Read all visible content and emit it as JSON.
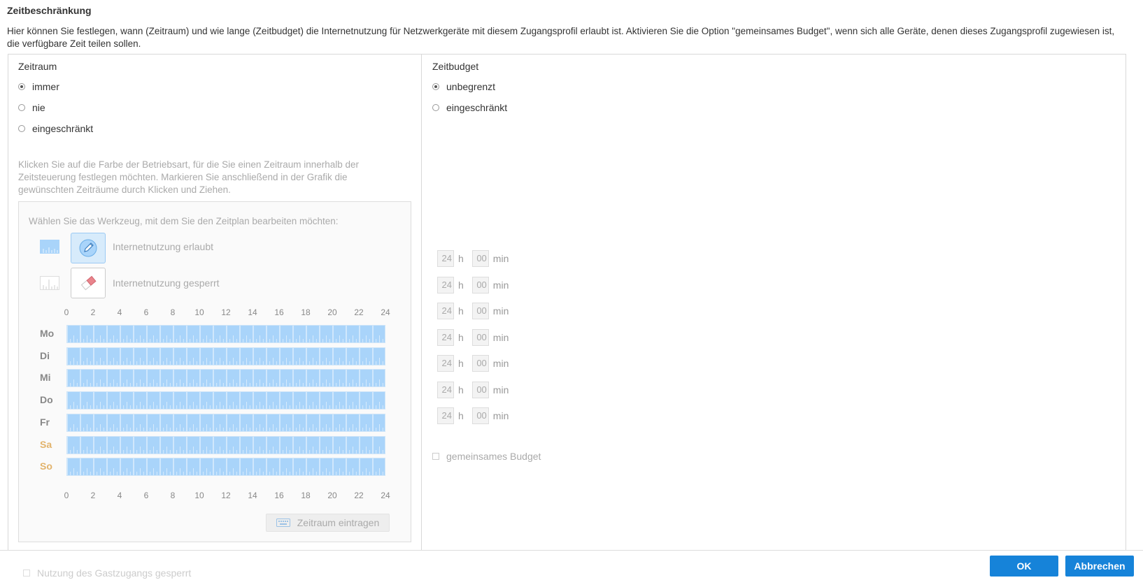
{
  "heading": "Zeitbeschränkung",
  "description": "Hier können Sie festlegen, wann (Zeitraum) und wie lange (Zeitbudget) die Internetnutzung für Netzwerkgeräte mit diesem Zugangsprofil erlaubt ist. Aktivieren Sie die Option \"gemeinsames Budget\", wenn sich alle Geräte, denen dieses Zugangsprofil zugewiesen ist, die verfügbare Zeit teilen sollen.",
  "zeitraum": {
    "title": "Zeitraum",
    "options": [
      {
        "label": "immer",
        "checked": true
      },
      {
        "label": "nie",
        "checked": false
      },
      {
        "label": "eingeschränkt",
        "checked": false
      }
    ],
    "hint": "Klicken Sie auf die Farbe der Betriebsart, für die Sie einen Zeitraum innerhalb der Zeitsteuerung festlegen möchten. Markieren Sie anschließend in der Grafik die gewünschten Zeiträume durch Klicken und Ziehen.",
    "tool_caption": "Wählen Sie das Werkzeug, mit dem Sie den Zeitplan bearbeiten möchten:",
    "tools": [
      {
        "label": "Internetnutzung erlaubt",
        "icon": "pencil-icon",
        "active": true,
        "color": "#a9d4fa"
      },
      {
        "label": "Internetnutzung gesperrt",
        "icon": "eraser-icon",
        "active": false,
        "color": "#ffffff"
      }
    ],
    "hours": [
      "0",
      "2",
      "4",
      "6",
      "8",
      "10",
      "12",
      "14",
      "16",
      "18",
      "20",
      "22",
      "24"
    ],
    "days": [
      {
        "label": "Mo",
        "weekend": false,
        "allowed_fraction": 1
      },
      {
        "label": "Di",
        "weekend": false,
        "allowed_fraction": 1
      },
      {
        "label": "Mi",
        "weekend": false,
        "allowed_fraction": 1
      },
      {
        "label": "Do",
        "weekend": false,
        "allowed_fraction": 1
      },
      {
        "label": "Fr",
        "weekend": false,
        "allowed_fraction": 1
      },
      {
        "label": "Sa",
        "weekend": true,
        "allowed_fraction": 1
      },
      {
        "label": "So",
        "weekend": true,
        "allowed_fraction": 1
      }
    ],
    "enter_button": "Zeitraum eintragen"
  },
  "zeitbudget": {
    "title": "Zeitbudget",
    "options": [
      {
        "label": "unbegrenzt",
        "checked": true
      },
      {
        "label": "eingeschränkt",
        "checked": false
      }
    ],
    "rows": [
      {
        "hours": "24",
        "minutes": "00"
      },
      {
        "hours": "24",
        "minutes": "00"
      },
      {
        "hours": "24",
        "minutes": "00"
      },
      {
        "hours": "24",
        "minutes": "00"
      },
      {
        "hours": "24",
        "minutes": "00"
      },
      {
        "hours": "24",
        "minutes": "00"
      },
      {
        "hours": "24",
        "minutes": "00"
      }
    ],
    "unit_h": "h",
    "unit_min": "min",
    "shared_budget_label": "gemeinsames Budget"
  },
  "guest_lock_label": "Nutzung des Gastzugangs gesperrt",
  "buttons": {
    "ok": "OK",
    "cancel": "Abbrechen"
  },
  "colors": {
    "accent": "#1683d9",
    "allowed": "#a9d4fa",
    "weekend": "#e2b36b"
  }
}
